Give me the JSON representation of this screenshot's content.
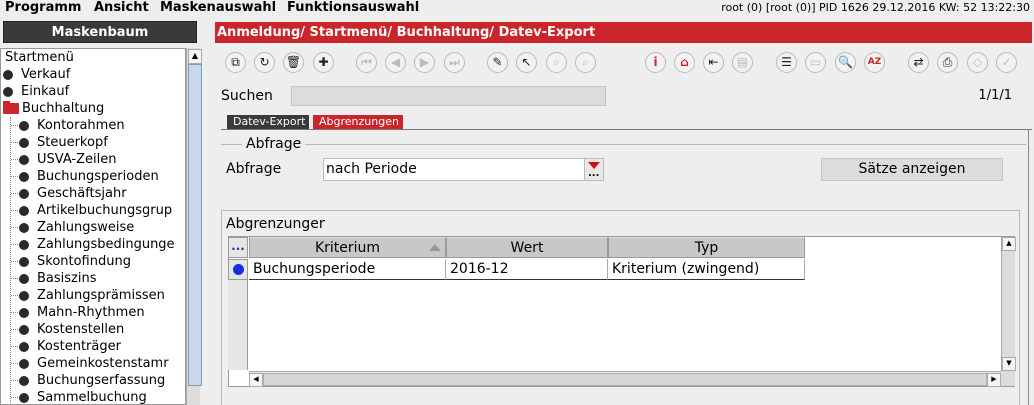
{
  "menubar": {
    "items": [
      "Programm",
      "Ansicht",
      "Maskenauswahl",
      "Funktionsauswahl"
    ],
    "status": "root (0) [root (0)] PID 1626  29.12.2016 KW: 52  13:22:30"
  },
  "left_panel": {
    "title": "Maskenbaum",
    "tree": {
      "root": "Startmenü",
      "top_items": [
        "Verkauf",
        "Einkauf"
      ],
      "open_folder": "Buchhaltung",
      "children": [
        "Kontorahmen",
        "Steuerkopf",
        "USVA-Zeilen",
        "Buchungsperioden",
        "Geschäftsjahr",
        "Artikelbuchungsgrup",
        "Zahlungsweise",
        "Zahlungsbedingunge",
        "Skontofindung",
        "Basiszins",
        "Zahlungsprämissen",
        "Mahn-Rhythmen",
        "Kostenstellen",
        "Kostenträger",
        "Gemeinkostenstamr",
        "Buchungserfassung",
        "Sammelbuchung"
      ]
    }
  },
  "right_panel": {
    "breadcrumb": "Anmeldung/ Startmenü/ Buchhaltung/ Datev-Export",
    "toolbar_icons": [
      "window-icon",
      "refresh-icon",
      "trash-icon",
      "add-icon",
      "first-icon",
      "prev-icon",
      "next-icon",
      "last-icon",
      "edit-icon",
      "pointer-icon",
      "search-replace-icon",
      "search-clear-icon",
      "info-icon",
      "home-icon",
      "exit-icon",
      "export-icon",
      "list-icon",
      "form-icon",
      "zoom-icon",
      "sort-az-icon",
      "swap-icon",
      "print-icon",
      "tag-icon",
      "check-icon"
    ],
    "search": {
      "label": "Suchen",
      "value": ""
    },
    "page_info": "1/1/1",
    "tabs": [
      "Datev-Export",
      "Abgrenzungen"
    ],
    "query": {
      "legend": "Abfrage",
      "label": "Abfrage",
      "selected": "nach Periode",
      "button_label": "Sätze anzeigen"
    },
    "grid": {
      "title": "Abgrenzungen",
      "corner_label": "...",
      "columns": [
        "Kriterium",
        "Wert",
        "Typ"
      ],
      "rows": [
        [
          "Buchungsperiode",
          "2016-12",
          "Kriterium (zwingend)"
        ]
      ]
    }
  },
  "colors": {
    "header_red": "#c9252b",
    "header_dark": "#3a3a3a",
    "row_marker_blue": "#1b2ce0"
  }
}
